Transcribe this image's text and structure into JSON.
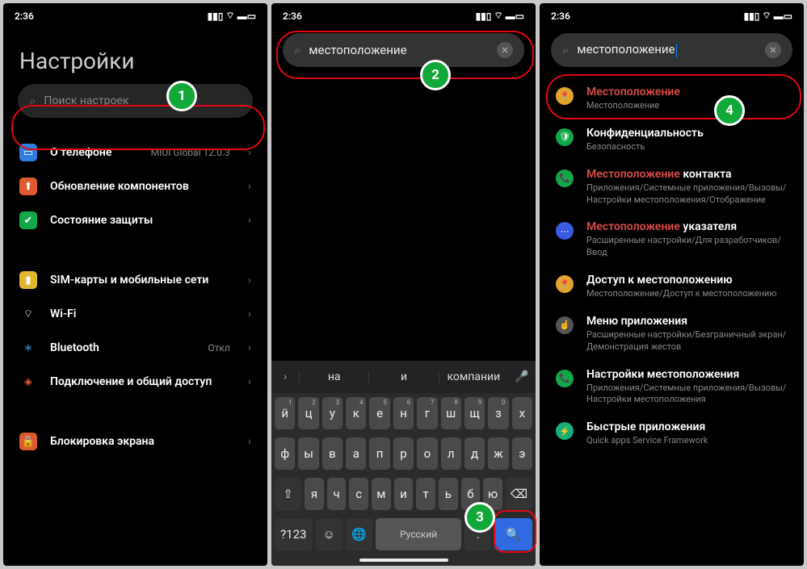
{
  "time": "2:36",
  "p1": {
    "title": "Настройки",
    "search_placeholder": "Поиск настроек",
    "items": [
      {
        "icon": "phone-icon",
        "bg": "#2f7de0",
        "label": "О телефоне",
        "value": "MIUI Global 12.0.3"
      },
      {
        "icon": "arrow-up-icon",
        "bg": "#e05a2f",
        "label": "Обновление компонентов"
      },
      {
        "icon": "shield-icon",
        "bg": "#12a84a",
        "label": "Состояние защиты"
      },
      {
        "gap": true
      },
      {
        "icon": "sim-icon",
        "bg": "#e0b62f",
        "label": "SIM-карты и мобильные сети"
      },
      {
        "icon": "wifi-icon",
        "bg": "transparent",
        "label": "Wi-Fi",
        "value": ""
      },
      {
        "icon": "bluetooth-icon",
        "bg": "transparent",
        "label": "Bluetooth",
        "value": "Откл"
      },
      {
        "icon": "share-icon",
        "bg": "transparent",
        "label": "Подключение и общий доступ"
      },
      {
        "gap": true
      },
      {
        "icon": "lock-icon",
        "bg": "#e05a2f",
        "label": "Блокировка экрана"
      }
    ]
  },
  "p2": {
    "search_value": "местоположение",
    "suggestions": [
      "на",
      "и",
      "компании"
    ],
    "rows": [
      [
        [
          "й",
          "1"
        ],
        [
          "ц",
          "2"
        ],
        [
          "у",
          "3"
        ],
        [
          "к",
          "4"
        ],
        [
          "е",
          "5"
        ],
        [
          "н",
          "6"
        ],
        [
          "г",
          "7"
        ],
        [
          "ш",
          "8"
        ],
        [
          "щ",
          "9"
        ],
        [
          "з",
          "0"
        ],
        [
          "х",
          ""
        ]
      ],
      [
        [
          "ф",
          ""
        ],
        [
          "ы",
          ""
        ],
        [
          "в",
          ""
        ],
        [
          "а",
          ""
        ],
        [
          "п",
          ""
        ],
        [
          "р",
          ""
        ],
        [
          "о",
          ""
        ],
        [
          "л",
          ""
        ],
        [
          "д",
          ""
        ],
        [
          "ж",
          ""
        ],
        [
          "э",
          ""
        ]
      ],
      [
        [
          "я",
          ""
        ],
        [
          "ч",
          ""
        ],
        [
          "с",
          ""
        ],
        [
          "м",
          ""
        ],
        [
          "и",
          ""
        ],
        [
          "т",
          ""
        ],
        [
          "ь",
          ""
        ],
        [
          "б",
          ""
        ],
        [
          "ю",
          ""
        ]
      ]
    ],
    "shift": "⇧",
    "backspace": "⌫",
    "bottom": {
      "numbers": "?123",
      "emoji": "☺",
      "globe": "🌐",
      "space": "Русский",
      "dot": ".",
      "search": "🔍"
    }
  },
  "p3": {
    "search_value": "местоположение",
    "results": [
      {
        "icon": "pin-icon",
        "bg": "#e0a52f",
        "title_html": [
          {
            "t": "Местоположение",
            "r": true
          }
        ],
        "sub": "Местоположение"
      },
      {
        "icon": "shield2-icon",
        "bg": "#12a84a",
        "title_html": [
          {
            "t": "Конфиденциальность"
          }
        ],
        "sub": "Безопасность"
      },
      {
        "icon": "phone2-icon",
        "bg": "#12a84a",
        "title_html": [
          {
            "t": "Местоположение",
            "r": true
          },
          {
            "t": " контакта"
          }
        ],
        "sub": "Приложения/Системные приложения/Вызовы/Настройки местоположения/Отображение"
      },
      {
        "icon": "dots-icon",
        "bg": "#3a5ae0",
        "title_html": [
          {
            "t": "Местоположение",
            "r": true
          },
          {
            "t": " указателя"
          }
        ],
        "sub": "Расширенные настройки/Для разработчиков/Ввод"
      },
      {
        "icon": "pin2-icon",
        "bg": "#e0a52f",
        "title_html": [
          {
            "t": "Доступ к местоположению"
          }
        ],
        "sub": "Местоположение/Доступ к местоположению"
      },
      {
        "icon": "finger-icon",
        "bg": "#555",
        "title_html": [
          {
            "t": "Меню приложения"
          }
        ],
        "sub": "Расширенные настройки/Безграничный экран/Демонстрация жестов"
      },
      {
        "icon": "phone3-icon",
        "bg": "#12a84a",
        "title_html": [
          {
            "t": "Настройки местоположения"
          }
        ],
        "sub": "Приложения/Системные приложения/Вызовы/Настройки местоположения"
      },
      {
        "icon": "bolt-icon",
        "bg": "#14b078",
        "title_html": [
          {
            "t": "Быстрые приложения"
          }
        ],
        "sub": "Quick apps Service Framework"
      }
    ]
  },
  "badges": {
    "1": "1",
    "2": "2",
    "3": "3",
    "4": "4"
  }
}
